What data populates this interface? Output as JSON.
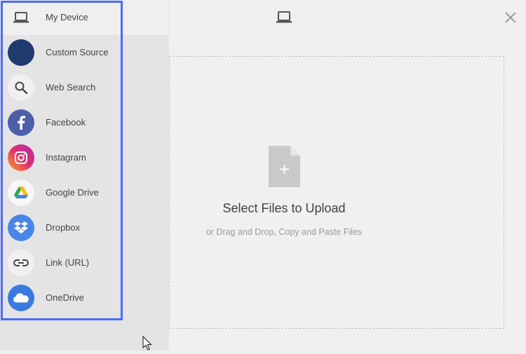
{
  "sidebar": {
    "items": [
      {
        "label": "My Device",
        "icon": "laptop-icon",
        "active": true
      },
      {
        "label": "Custom Source",
        "icon": "custom-source-icon",
        "color": "#1e3a6e"
      },
      {
        "label": "Web Search",
        "icon": "search-icon",
        "color": "#f0f0f0"
      },
      {
        "label": "Facebook",
        "icon": "facebook-icon",
        "color": "#4c5fa8"
      },
      {
        "label": "Instagram",
        "icon": "instagram-icon",
        "color": "#e1306c"
      },
      {
        "label": "Google Drive",
        "icon": "google-drive-icon",
        "color": "#f7f7f7"
      },
      {
        "label": "Dropbox",
        "icon": "dropbox-icon",
        "color": "#4a86e8"
      },
      {
        "label": "Link (URL)",
        "icon": "link-icon",
        "color": "#f0f0f0"
      },
      {
        "label": "OneDrive",
        "icon": "onedrive-icon",
        "color": "#3a79e0"
      }
    ]
  },
  "header": {
    "icon": "laptop-icon",
    "close_icon": "close-icon"
  },
  "dropzone": {
    "title": "Select Files to Upload",
    "subtitle": "or Drag and Drop, Copy and Paste Files",
    "icon": "file-add-icon"
  },
  "colors": {
    "highlight": "#4a6cf7",
    "sidebar_bg": "#e4e4e4",
    "main_bg": "#f0f0f0"
  }
}
